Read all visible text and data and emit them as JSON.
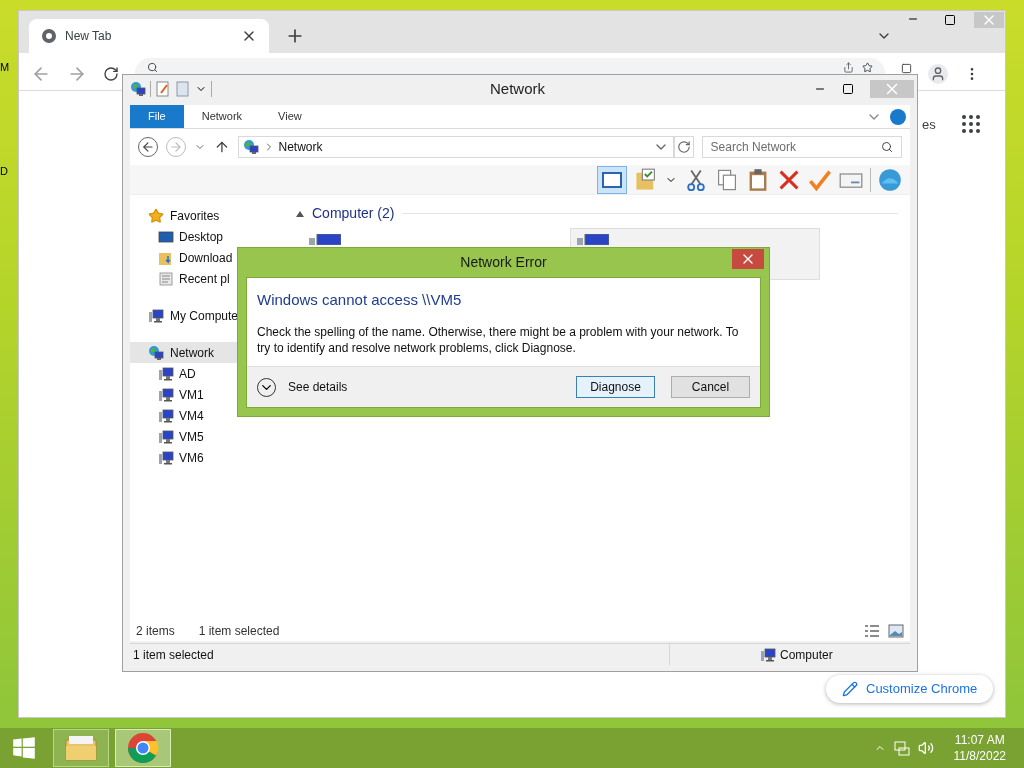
{
  "desktop": {
    "icon_labels": [
      "M",
      "D"
    ]
  },
  "browser": {
    "tab_title": "New Tab",
    "shortcut_text": "es",
    "customize_button": "Customize Chrome"
  },
  "explorer": {
    "title": "Network",
    "ribbon_tabs": [
      {
        "label": "File",
        "selected": true
      },
      {
        "label": "Network",
        "selected": false
      },
      {
        "label": "View",
        "selected": false
      }
    ],
    "address": "Network",
    "search_placeholder": "Search Network",
    "sidebar": [
      {
        "label": "Favorites",
        "kind": "star",
        "selected": false,
        "children": [
          {
            "label": "Desktop",
            "kind": "desktop",
            "selected": false
          },
          {
            "label": "Download",
            "kind": "downloads",
            "selected": false
          },
          {
            "label": "Recent pl",
            "kind": "recent",
            "selected": false
          }
        ]
      },
      {
        "label": "My Compute",
        "kind": "computer",
        "selected": false
      },
      {
        "label": "Network",
        "kind": "network",
        "selected": true,
        "children": [
          {
            "label": "AD",
            "kind": "computer",
            "selected": false
          },
          {
            "label": "VM1",
            "kind": "computer",
            "selected": false
          },
          {
            "label": "VM4",
            "kind": "computer",
            "selected": false
          },
          {
            "label": "VM5",
            "kind": "computer",
            "selected": false
          },
          {
            "label": "VM6",
            "kind": "computer",
            "selected": false
          }
        ]
      }
    ],
    "group": {
      "label": "Computer (2)",
      "items": [
        {
          "selected": false
        },
        {
          "selected": true
        }
      ]
    },
    "details": {
      "count": "2 items",
      "selection": "1 item selected"
    },
    "status_bar": {
      "left": "1 item selected",
      "right": "Computer"
    }
  },
  "dialog": {
    "title": "Network Error",
    "heading": "Windows cannot access \\\\VM5",
    "message": "Check the spelling of the name. Otherwise, there might be a problem with your network. To try to identify and resolve network problems, click Diagnose.",
    "details_label": "See details",
    "buttons": [
      {
        "label": "Diagnose",
        "default": true
      },
      {
        "label": "Cancel",
        "default": false
      }
    ]
  },
  "taskbar": {
    "buttons": [
      {
        "kind": "explorer",
        "active": false
      },
      {
        "kind": "chrome",
        "active": true
      }
    ],
    "time": "11:07 AM",
    "date": "11/8/2022"
  }
}
